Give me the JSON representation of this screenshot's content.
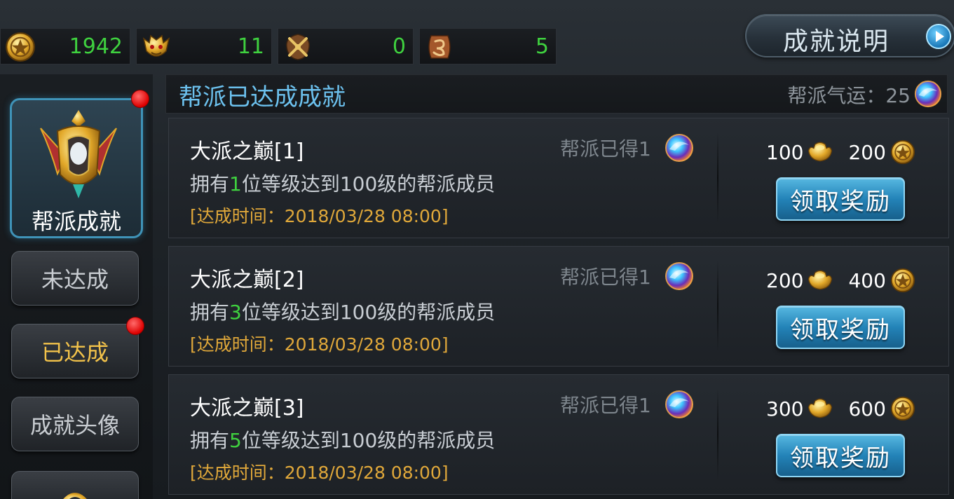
{
  "currencies": [
    {
      "icon": "coin-medal-icon",
      "value": "1942"
    },
    {
      "icon": "demon-mask-icon",
      "value": "11"
    },
    {
      "icon": "crossed-swords-icon",
      "value": "0"
    },
    {
      "icon": "dragon-token-icon",
      "value": "5"
    }
  ],
  "help_button": {
    "label": "成就说明",
    "icon": "play-arrow-icon"
  },
  "sidebar": {
    "main_tab": {
      "label": "帮派成就",
      "icon": "guild-crest-icon"
    },
    "tabs": [
      {
        "label": "未达成"
      },
      {
        "label": "已达成"
      },
      {
        "label": "成就头像"
      }
    ]
  },
  "header": {
    "title": "帮派已达成成就",
    "luck_label": "帮派气运：25",
    "luck_icon": "luck-orb-icon"
  },
  "achievements": [
    {
      "name": "大派之巅[1]",
      "desc_pre": "拥有",
      "desc_num": "1",
      "desc_post": "位等级达到100级的帮派成员",
      "time": "[达成时间：2018/03/28  08:00]",
      "got": "帮派已得1",
      "reward1": "100",
      "reward2": "200",
      "claim": "领取奖励"
    },
    {
      "name": "大派之巅[2]",
      "desc_pre": "拥有",
      "desc_num": "3",
      "desc_post": "位等级达到100级的帮派成员",
      "time": "[达成时间：2018/03/28  08:00]",
      "got": "帮派已得1",
      "reward1": "200",
      "reward2": "400",
      "claim": "领取奖励"
    },
    {
      "name": "大派之巅[3]",
      "desc_pre": "拥有",
      "desc_num": "5",
      "desc_post": "位等级达到100级的帮派成员",
      "time": "[达成时间：2018/03/28  08:00]",
      "got": "帮派已得1",
      "reward1": "300",
      "reward2": "600",
      "claim": "领取奖励"
    }
  ],
  "colors": {
    "accent_blue": "#6cc1ee",
    "value_green": "#3fd13f",
    "time_orange": "#e0a83a",
    "active_tab": "#f2c24a"
  }
}
